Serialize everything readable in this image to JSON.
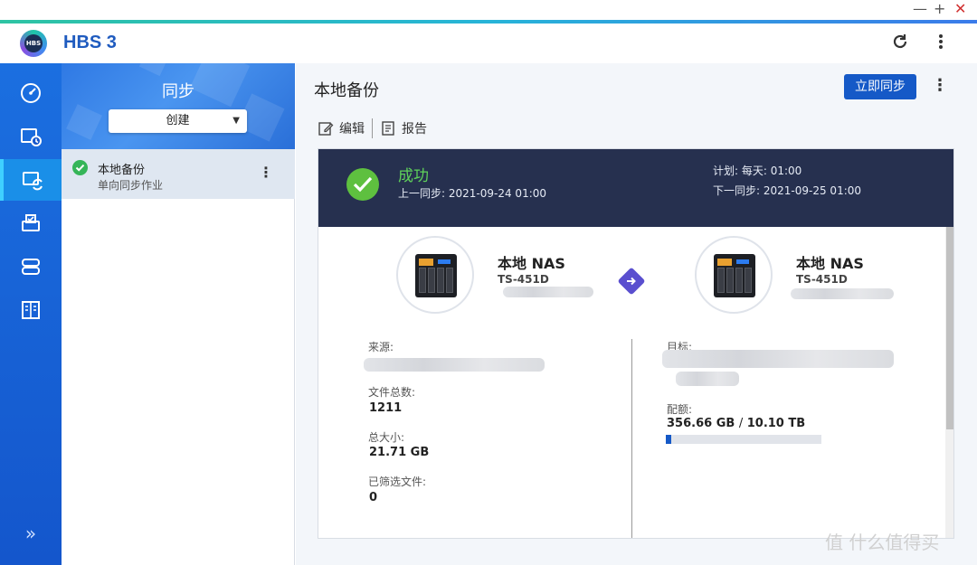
{
  "window": {
    "minimize": "—",
    "maximize": "+",
    "close": "✕"
  },
  "app": {
    "title": "HBS 3",
    "logo_text": "HBS"
  },
  "header": {
    "refresh_icon": "refresh-icon",
    "more_icon": "more-vertical-icon"
  },
  "rail": {
    "items": [
      {
        "icon": "dashboard-icon"
      },
      {
        "icon": "backup-icon"
      },
      {
        "icon": "sync-icon",
        "active": true
      },
      {
        "icon": "restore-icon"
      },
      {
        "icon": "storage-icon"
      },
      {
        "icon": "logs-icon"
      }
    ],
    "expand": "»"
  },
  "panel": {
    "title": "同步",
    "create_label": "创建",
    "jobs": [
      {
        "name": "本地备份",
        "subtitle": "单向同步作业",
        "status": "success"
      }
    ]
  },
  "main": {
    "title": "本地备份",
    "sync_now_label": "立即同步",
    "toolbar": {
      "edit_label": "编辑",
      "report_label": "报告"
    },
    "banner": {
      "status": "成功",
      "last_sync_label": "上一同步:",
      "last_sync_value": "2021-09-24 01:00",
      "schedule_label": "计划:",
      "schedule_value": "每天: 01:00",
      "next_sync_label": "下一同步:",
      "next_sync_value": "2021-09-25 01:00"
    },
    "source_nas": {
      "title": "本地 NAS",
      "model": "TS-451D"
    },
    "target_nas": {
      "title": "本地 NAS",
      "model": "TS-451D"
    },
    "source": {
      "source_label": "来源:",
      "file_count_label": "文件总数:",
      "file_count": "1211",
      "total_size_label": "总大小:",
      "total_size": "21.71 GB",
      "filtered_label": "已筛选文件:",
      "filtered": "0"
    },
    "target": {
      "target_label": "目标:",
      "quota_label": "配额:",
      "quota_used": "356.66 GB",
      "quota_sep": "/",
      "quota_total": "10.10 TB",
      "quota_fraction": 0.035
    }
  },
  "watermark": "值 什么值得买",
  "colors": {
    "accent": "#1559c7",
    "success": "#5ec03f",
    "banner_bg": "#26304f",
    "rail_bg": "#1456cc"
  }
}
